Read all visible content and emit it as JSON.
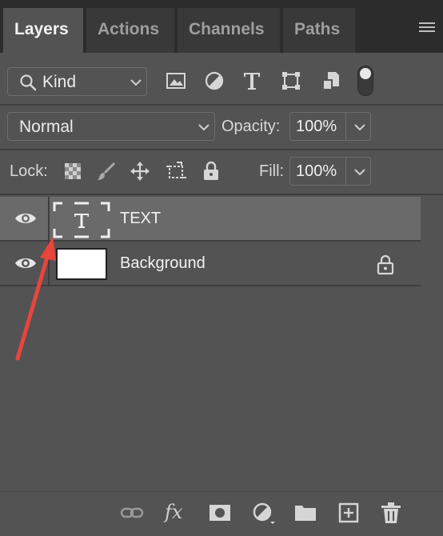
{
  "tabs": [
    {
      "label": "Layers",
      "active": true
    },
    {
      "label": "Actions",
      "active": false
    },
    {
      "label": "Channels",
      "active": false
    },
    {
      "label": "Paths",
      "active": false
    }
  ],
  "filter": {
    "kind_label": "Kind",
    "icons": [
      "image-filter-icon",
      "adjustment-filter-icon",
      "type-filter-icon",
      "shape-filter-icon",
      "smart-object-filter-icon"
    ],
    "toggle_on": true
  },
  "blend": {
    "mode": "Normal",
    "opacity_label": "Opacity:",
    "opacity_value": "100%"
  },
  "lock": {
    "label": "Lock:",
    "icons": [
      "lock-transparent-pixels-icon",
      "lock-image-pixels-icon",
      "lock-position-icon",
      "lock-artboard-icon",
      "lock-all-icon"
    ],
    "fill_label": "Fill:",
    "fill_value": "100%"
  },
  "layers": [
    {
      "name": "TEXT",
      "type": "text",
      "visible": true,
      "selected": true,
      "locked": false
    },
    {
      "name": "Background",
      "type": "pixel",
      "visible": true,
      "selected": false,
      "locked": true
    }
  ],
  "footer_icons": [
    "link-layers-icon",
    "fx-icon",
    "mask-icon",
    "adjustment-layer-icon",
    "folder-icon",
    "new-layer-icon",
    "trash-icon"
  ],
  "footer": {
    "fx_label": "fx"
  },
  "colors": {
    "panel": "#535353",
    "tabbar": "#2c2c2c",
    "selected_row": "#6a6a6a",
    "annotation_arrow": "#e8453c"
  }
}
